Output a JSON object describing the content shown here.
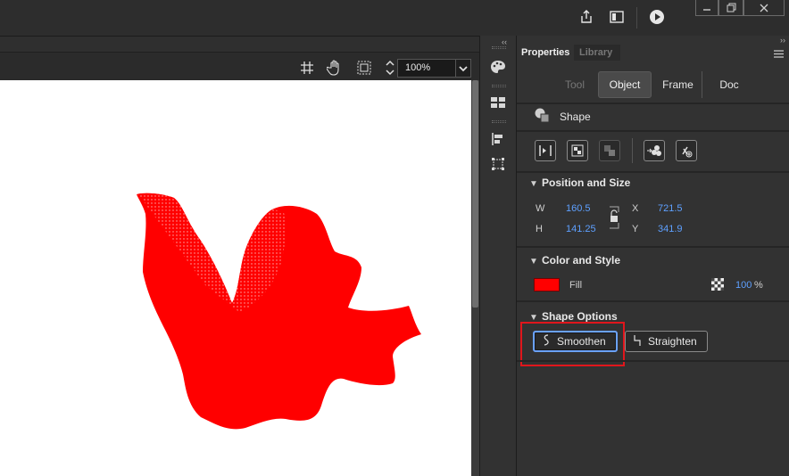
{
  "titlebar": {
    "icons": [
      "share-icon",
      "panel-layout-icon",
      "play-icon"
    ],
    "window_controls": [
      "minimize",
      "restore",
      "close"
    ]
  },
  "stage_toolbar": {
    "icons": [
      "snap-icon",
      "pan-hand-icon",
      "clip-canvas-icon"
    ],
    "zoom_value": "100%"
  },
  "toolstrip": {
    "icons": [
      "palette-icon",
      "swatches-icon",
      "align-icon",
      "transform-icon"
    ]
  },
  "panel": {
    "tabs": {
      "properties": "Properties",
      "library": "Library"
    },
    "mode_tabs": {
      "tool": "Tool",
      "object": "Object",
      "frame": "Frame",
      "doc": "Doc"
    },
    "object_type": "Shape",
    "position_size": {
      "title": "Position and Size",
      "w_label": "W",
      "w_value": "160.5",
      "h_label": "H",
      "h_value": "141.25",
      "x_label": "X",
      "x_value": "721.5",
      "y_label": "Y",
      "y_value": "341.9"
    },
    "color_style": {
      "title": "Color and Style",
      "fill_label": "Fill",
      "fill_color": "#ff0000",
      "alpha_value": "100",
      "alpha_unit": "%"
    },
    "shape_options": {
      "title": "Shape Options",
      "smoothen_label": "Smoothen",
      "straighten_label": "Straighten"
    }
  },
  "colors": {
    "shape_fill": "#ff0000",
    "highlight_border": "#e0161c",
    "value_blue": "#5ea0ff"
  }
}
